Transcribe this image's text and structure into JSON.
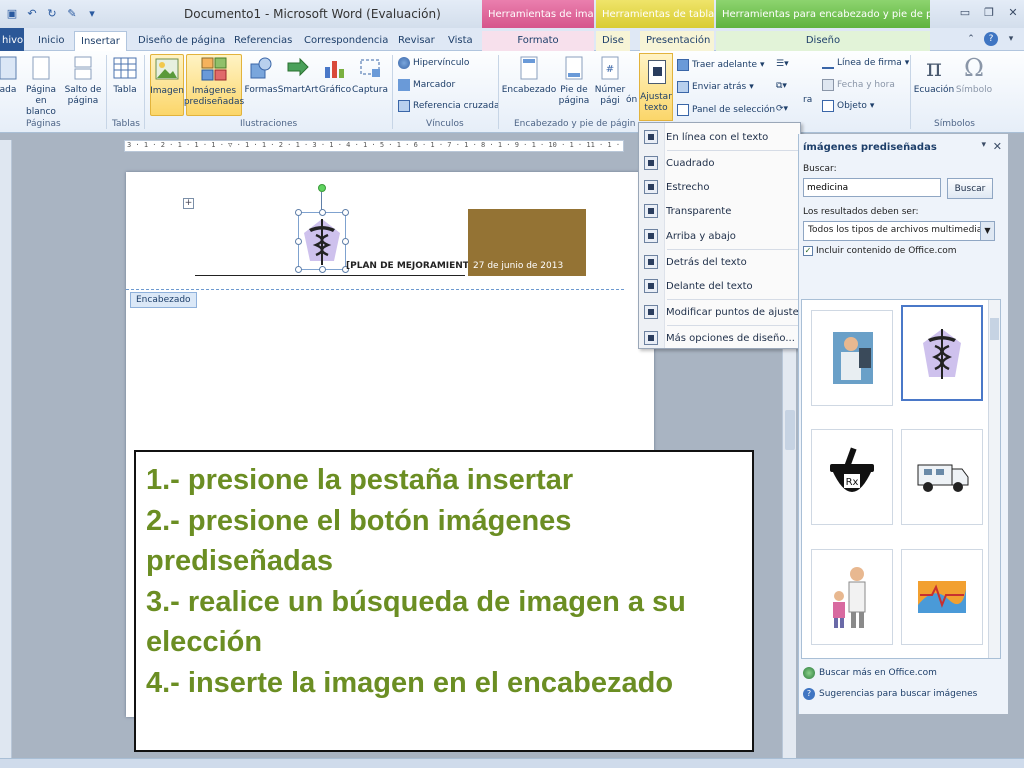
{
  "window": {
    "title": "Documento1  -  Microsoft Word (Evaluación)",
    "context_tabs": [
      "Herramientas de imagen",
      "Herramientas de tabla",
      "Herramientas para encabezado y pie de página"
    ]
  },
  "tabs": [
    {
      "label": "hivo"
    },
    {
      "label": "Inicio"
    },
    {
      "label": "Insertar"
    },
    {
      "label": "Diseño de página"
    },
    {
      "label": "Referencias"
    },
    {
      "label": "Correspondencia"
    },
    {
      "label": "Revisar"
    },
    {
      "label": "Vista"
    },
    {
      "label": "Formato"
    },
    {
      "label": "Dise"
    },
    {
      "label": "Presentación"
    },
    {
      "label": "Diseño"
    }
  ],
  "ribbon": {
    "buttons": {
      "portada": "ada",
      "pagina_blanco": "Página en blanco",
      "salto_pagina": "Salto de página",
      "tabla": "Tabla",
      "imagen": "Imagen",
      "imagenes_prediseñadas": "Imágenes prediseñadas",
      "formas": "Formas",
      "smartart": "SmartArt",
      "grafico": "Gráfico",
      "captura": "Captura",
      "hipervinculo": "Hipervínculo",
      "marcador": "Marcador",
      "referencia_cruzada": "Referencia cruzada",
      "encabezado": "Encabezado",
      "pie_pagina": "Pie de página",
      "numero_pagina": "Númer pági",
      "on": "ón",
      "ajustar_texto": "Ajustar texto",
      "traer_adelante": "Traer adelante",
      "enviar_atras": "Enviar atrás",
      "panel_seleccion": "Panel de selección",
      "linea_firma": "Línea de firma",
      "fecha_hora": "Fecha y hora",
      "objeto": "Objeto",
      "ecuacion": "Ecuación",
      "simbolo": "Símbolo",
      "ra": "ra"
    },
    "groups": {
      "paginas": "Páginas",
      "tablas": "Tablas",
      "ilustraciones": "Ilustraciones",
      "vinculos": "Vínculos",
      "encabezado_pie": "Encabezado y pie de págin",
      "simbolos": "Símbolos"
    }
  },
  "ruler": {
    "text": "3 · 1 · 2 · 1 · 1 · 1 · ▽ · 1 · 1 · 2 · 1 · 3 · 1 · 4 · 1 · 5 · 1 · 6 · 1 · 7 · 1 · 8 · 1 · 9 · 1 · 10 · 1 · 11 · 1 · 12 · 1 · 13 · 1 · 14 · 1 · 15 · 1 · 16"
  },
  "document": {
    "header_text": "[PLAN DE MEJORAMIENTO]",
    "date_text": "27 de junio de 2013",
    "header_tag": "Encabezado",
    "date_box_color": "#947334"
  },
  "wrap_menu": {
    "items": [
      {
        "label": "En línea con el texto"
      },
      {
        "label": "Cuadrado"
      },
      {
        "label": "Estrecho"
      },
      {
        "label": "Transparente"
      },
      {
        "label": "Arriba y abajo"
      },
      {
        "label": "Detrás del texto"
      },
      {
        "label": "Delante del texto"
      },
      {
        "label": "Modificar puntos de ajuste"
      },
      {
        "label": "Más opciones de diseño..."
      }
    ]
  },
  "clip_pane": {
    "title": "ímágenes prediseñadas",
    "search_label": "Buscar:",
    "search_value": "medicina",
    "search_button": "Buscar",
    "results_label": "Los resultados deben ser:",
    "results_value": "Todos los tipos de archivos multimedia",
    "include_office": "Incluir contenido de Office.com",
    "include_office_checked": true,
    "thumbnails": [
      "doctor-clipart",
      "caduceus-clipart",
      "rx-mortar-clipart",
      "ambulance-clipart",
      "nurse-child-clipart",
      "medical-abstract-clipart"
    ],
    "link_more": "Buscar más en Office.com",
    "link_tips": "Sugerencias para buscar imágenes"
  },
  "instructions": {
    "step1": "1.- presione la pestaña insertar",
    "step2": "2.- presione el botón imágenes prediseñadas",
    "step3": "3.- realice un búsqueda de imagen a su elección",
    "step4": "4.- inserte la imagen en el encabezado",
    "color": "#6b8e23"
  }
}
